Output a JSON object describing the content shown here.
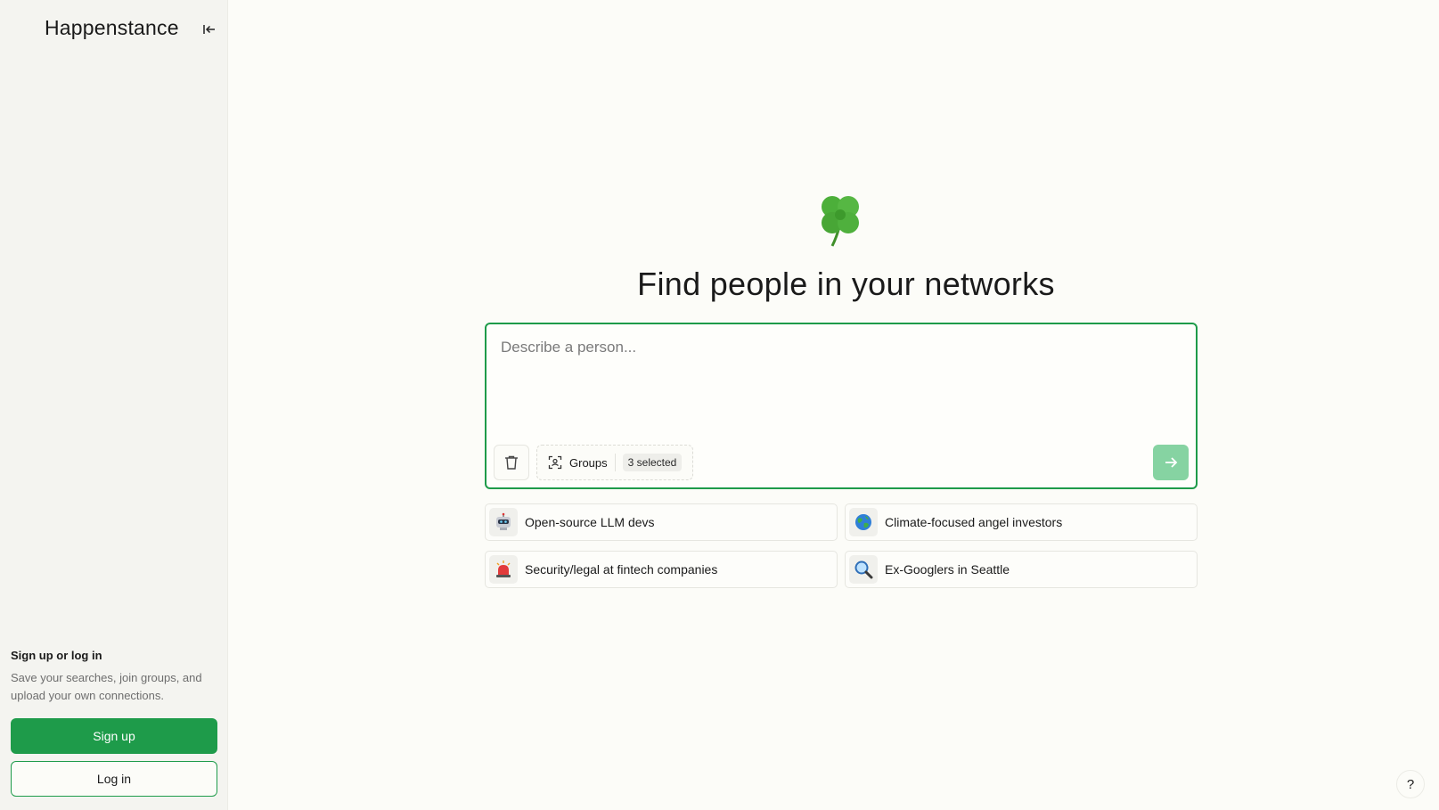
{
  "sidebar": {
    "brand": "Happenstance",
    "collapse_icon": "collapse-left-icon",
    "auth": {
      "title": "Sign up or log in",
      "description": "Save your searches, join groups, and upload your own connections.",
      "signup_label": "Sign up",
      "login_label": "Log in"
    }
  },
  "main": {
    "hero_icon": "four-leaf-clover-icon",
    "headline": "Find people in your networks",
    "search": {
      "placeholder": "Describe a person...",
      "value": "",
      "groups_label": "Groups",
      "groups_badge": "3 selected"
    },
    "suggestions": [
      {
        "label": "Open-source LLM devs",
        "icon": "robot-icon"
      },
      {
        "label": "Climate-focused angel investors",
        "icon": "globe-icon"
      },
      {
        "label": "Security/legal at fintech companies",
        "icon": "siren-icon"
      },
      {
        "label": "Ex-Googlers in Seattle",
        "icon": "magnifier-icon"
      }
    ],
    "help_label": "?"
  },
  "colors": {
    "accent": "#1e9b4a",
    "accent_light": "#86d3a2",
    "sidebar_bg": "#f4f4f0",
    "page_bg": "#fcfcf8"
  }
}
